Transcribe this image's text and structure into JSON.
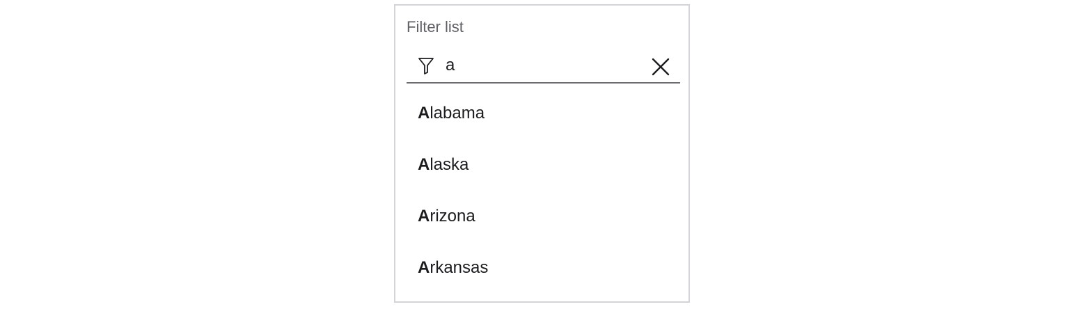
{
  "filter_panel": {
    "title": "Filter list",
    "search": {
      "value": "a",
      "icon": "filter-icon",
      "clear_icon": "close-icon"
    },
    "results": [
      {
        "match": "A",
        "rest": "labama"
      },
      {
        "match": "A",
        "rest": "laska"
      },
      {
        "match": "A",
        "rest": "rizona"
      },
      {
        "match": "A",
        "rest": "rkansas"
      }
    ]
  },
  "colors": {
    "panel_border": "#d4d4d8",
    "title_text": "#5f6166",
    "underline": "#6b6b70",
    "text": "#1c1c1e"
  }
}
